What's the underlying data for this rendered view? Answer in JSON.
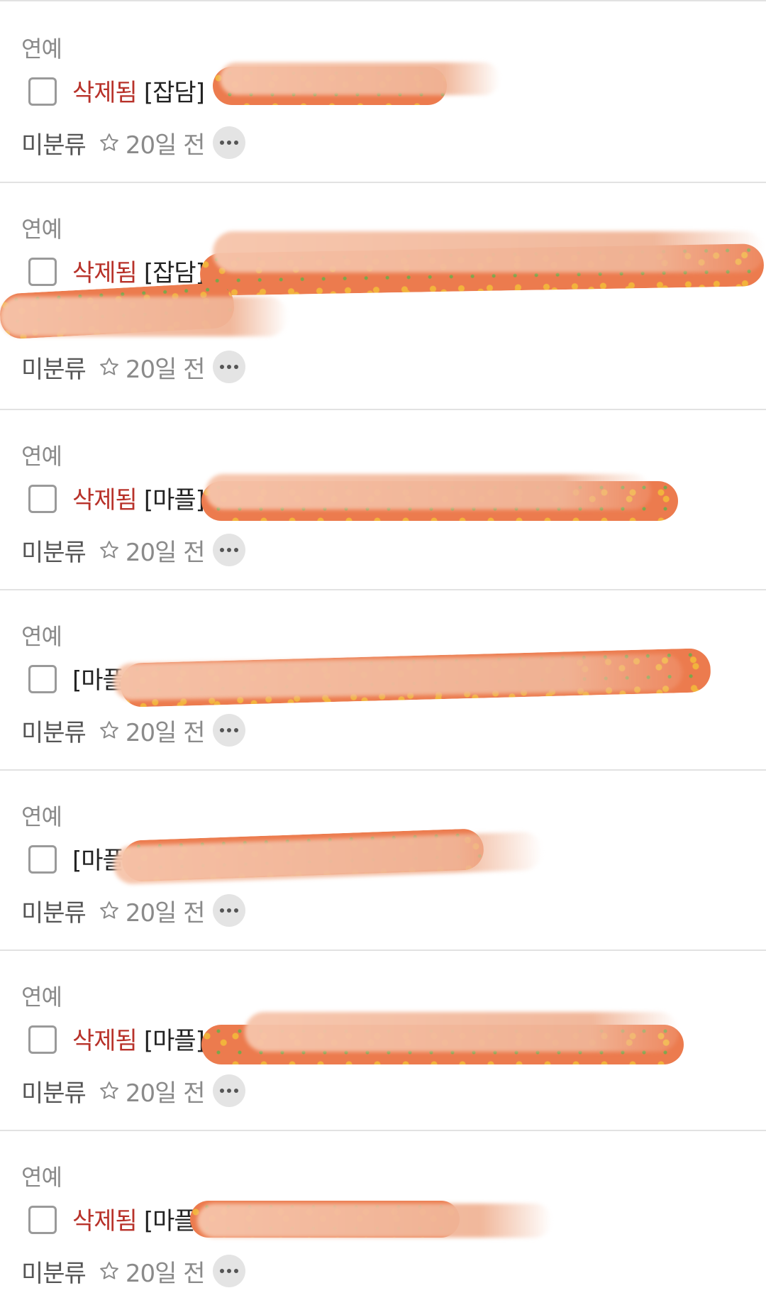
{
  "items": [
    {
      "category": "연예",
      "deleted_label": "삭제됨",
      "tag": "[잡담]",
      "board": "미분류",
      "time": "20일 전"
    },
    {
      "category": "연예",
      "deleted_label": "삭제됨",
      "tag": "[잡담]",
      "board": "미분류",
      "time": "20일 전"
    },
    {
      "category": "연예",
      "deleted_label": "삭제됨",
      "tag": "[마플]",
      "board": "미분류",
      "time": "20일 전"
    },
    {
      "category": "연예",
      "deleted_label": "",
      "tag": "[마플]",
      "board": "미분류",
      "time": "20일 전"
    },
    {
      "category": "연예",
      "deleted_label": "",
      "tag": "[마플]",
      "board": "미분류",
      "time": "20일 전"
    },
    {
      "category": "연예",
      "deleted_label": "삭제됨",
      "tag": "[마플]",
      "board": "미분류",
      "time": "20일 전"
    },
    {
      "category": "연예",
      "deleted_label": "삭제됨",
      "tag": "[마플]",
      "board": "미분류",
      "time": "20일 전"
    }
  ],
  "colors": {
    "deleted": "#b8322a",
    "divider": "#e2e2e2",
    "muted": "#8a8a8a",
    "redaction": "#ec7b4e"
  },
  "icons": {
    "star": "star-outline-icon",
    "more": "more-horizontal-icon"
  }
}
